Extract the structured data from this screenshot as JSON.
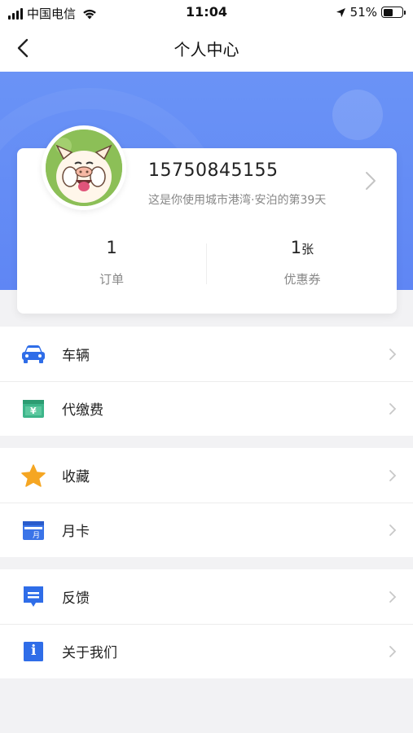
{
  "status_bar": {
    "carrier": "中国电信",
    "time": "11:04",
    "battery_percent": "51%",
    "battery_level": 0.51
  },
  "nav": {
    "title": "个人中心",
    "back_icon": "chevron-left-icon"
  },
  "profile": {
    "phone": "15750845155",
    "usage_text": "这是你使用城市港湾·安泊的第39天",
    "stats": [
      {
        "value": "1",
        "unit": "",
        "label": "订单"
      },
      {
        "value": "1",
        "unit": "张",
        "label": "优惠券"
      }
    ]
  },
  "menu_groups": [
    [
      {
        "label": "车辆",
        "icon": "car-icon",
        "color": "#2f6de8"
      },
      {
        "label": "代缴费",
        "icon": "payment-icon",
        "color": "#3db58a"
      }
    ],
    [
      {
        "label": "收藏",
        "icon": "star-icon",
        "color": "#f5a623"
      },
      {
        "label": "月卡",
        "icon": "monthly-card-icon",
        "color": "#3a74e8"
      }
    ],
    [
      {
        "label": "反馈",
        "icon": "feedback-icon",
        "color": "#2f6de8"
      },
      {
        "label": "关于我们",
        "icon": "info-icon",
        "color": "#2f6de8"
      }
    ]
  ],
  "icon_badges": {
    "payment": "¥",
    "monthly_card": "月",
    "info": "i"
  }
}
